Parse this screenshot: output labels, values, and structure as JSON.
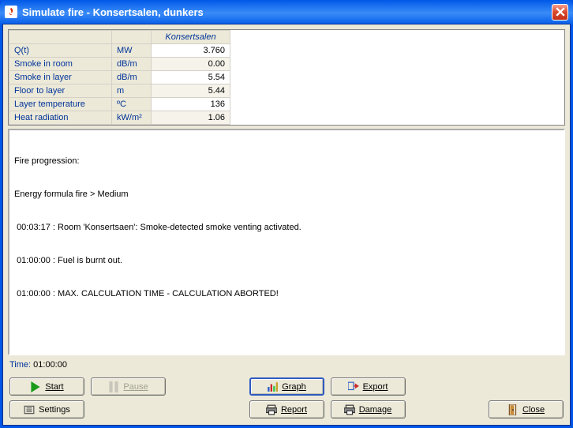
{
  "window": {
    "title": "Simulate fire - Konsertsalen, dunkers"
  },
  "table": {
    "col_header": "Konsertsalen",
    "rows": [
      {
        "label": "Q(t)",
        "unit": "MW",
        "value": "3.760"
      },
      {
        "label": "Smoke in room",
        "unit": "dB/m",
        "value": "0.00"
      },
      {
        "label": "Smoke in layer",
        "unit": "dB/m",
        "value": "5.54"
      },
      {
        "label": "Floor to layer",
        "unit": "m",
        "value": "5.44"
      },
      {
        "label": "Layer temperature",
        "unit": "ºC",
        "value": "136"
      },
      {
        "label": "Heat radiation",
        "unit": "kW/m²",
        "value": "1.06"
      }
    ]
  },
  "log": {
    "lines": [
      "Fire progression:",
      "Energy formula fire > Medium",
      " 00:03:17 : Room 'Konsertsaen': Smoke-detected smoke venting activated.",
      " 01:00:00 : Fuel is burnt out.",
      " 01:00:00 : MAX. CALCULATION TIME - CALCULATION ABORTED!"
    ]
  },
  "time": {
    "label": "Time: ",
    "value": "01:00:00"
  },
  "buttons": {
    "start": "Start",
    "pause": "Pause",
    "graph": "Graph",
    "export": "Export",
    "settings": "Settings",
    "report": "Report",
    "damage": "Damage",
    "close": "Close"
  }
}
